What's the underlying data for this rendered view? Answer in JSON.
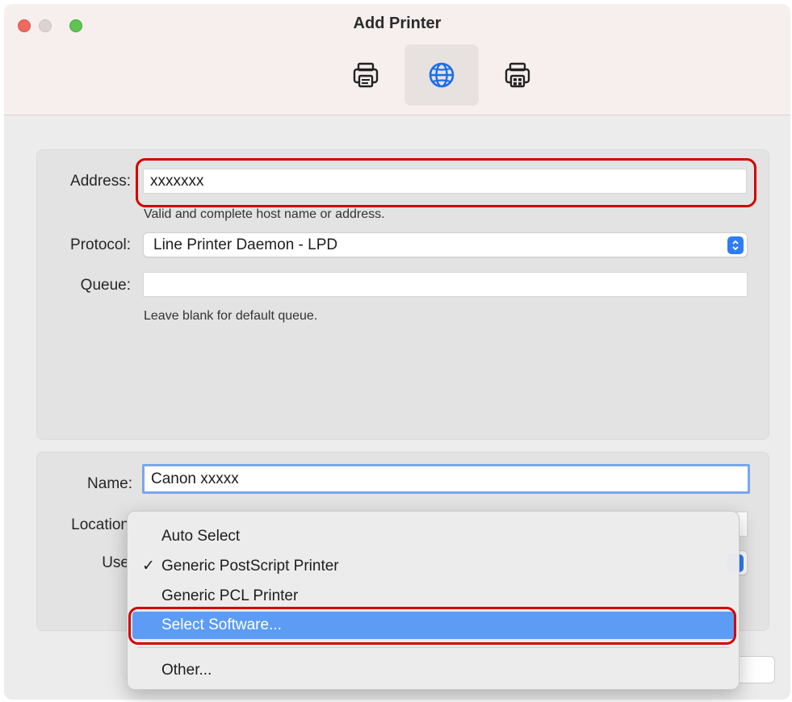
{
  "window": {
    "title": "Add Printer"
  },
  "toolbar": {
    "items": [
      {
        "icon": "printer-icon"
      },
      {
        "icon": "globe-icon",
        "selected": true
      },
      {
        "icon": "windows-printer-icon"
      }
    ]
  },
  "ip_form": {
    "address_label": "Address:",
    "address_value": "xxxxxxx",
    "address_hint": "Valid and complete host name or address.",
    "protocol_label": "Protocol:",
    "protocol_value": "Line Printer Daemon - LPD",
    "queue_label": "Queue:",
    "queue_value": "",
    "queue_hint": "Leave blank for default queue."
  },
  "details": {
    "name_label": "Name:",
    "name_value": "Canon xxxxx",
    "location_label": "Location",
    "use_label": "Use"
  },
  "use_menu": {
    "items": [
      {
        "label": "Auto Select",
        "checked": false
      },
      {
        "label": "Generic PostScript Printer",
        "checked": true,
        "check_mark": "✓"
      },
      {
        "label": "Generic PCL Printer",
        "checked": false
      },
      {
        "label": "Select Software...",
        "highlighted": true
      },
      {
        "label": "Other...",
        "checked": false
      }
    ]
  },
  "colors": {
    "accent": "#2f7cf6",
    "menu_highlight": "#5c9cf5",
    "annotation_red": "#d40000"
  }
}
